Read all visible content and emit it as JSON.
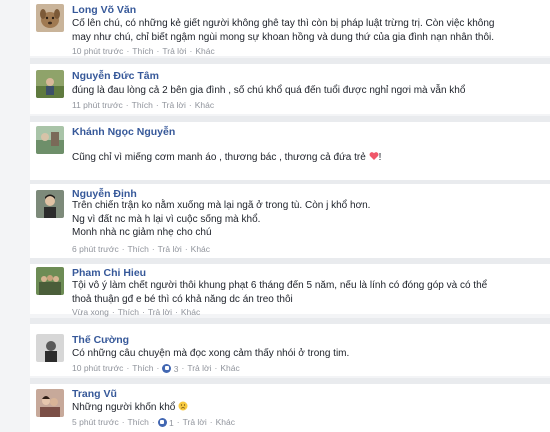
{
  "comments": [
    {
      "name": "Long Võ Văn",
      "lines": [
        "Cố lên chú, có những kẻ giết người không ghê tay thì còn bị pháp luật trừng trị. Còn việc không",
        "may như chú, chỉ biết ngậm ngùi mong sự khoan hồng và dung thứ của gia đình nạn nhân thôi."
      ],
      "time": "10 phút trước",
      "like": "Thích",
      "reply": "Trả lời",
      "other": "Khác",
      "avatar_icon": "dog-photo-icon"
    },
    {
      "name": "Nguyễn Đức Tâm",
      "lines": [
        "đúng là đau lòng cả 2 bên gia đình , số chú khổ quá đến tuổi được nghỉ ngơi mà vẫn khổ"
      ],
      "time": "11 phút trước",
      "like": "Thích",
      "reply": "Trả lời",
      "other": "Khác",
      "avatar_icon": "outdoor-photo-icon"
    },
    {
      "name": "Khánh Ngọc Nguyễn",
      "lines": [
        "Cũng chỉ vì miếng cơm manh áo , thương bác , thương cả đứa trẻ"
      ],
      "time": "",
      "like": "",
      "reply": "",
      "other": "",
      "avatar_icon": "landscape-photo-icon"
    },
    {
      "name": "Nguyễn Định",
      "lines": [
        "Trên chiến trận ko nằm xuống mà lại ngã ở trong tù. Còn j khổ hơn.",
        "Ng vì đất nc mà h lại vì cuộc sống mà khổ.",
        "Monh nhà nc giảm nhẹ cho chú"
      ],
      "time": "6 phút trước",
      "like": "Thích",
      "reply": "Trả lời",
      "other": "Khác",
      "avatar_icon": "portrait-photo-icon"
    },
    {
      "name": "Pham Chi Hieu",
      "lines": [
        "Tội vô ý làm chết người thôi khung phạt 6 tháng đến 5 năm, nếu là lính có đóng góp và có thể",
        "thoả thuận gđ e bé thì có khả năng dc án treo thôi"
      ],
      "time": "Vừa xong",
      "like": "Thích",
      "reply": "Trả lời",
      "other": "Khác",
      "avatar_icon": "group-photo-icon"
    },
    {
      "name": "Thế Cường",
      "lines": [
        "Có những câu chuyện mà đọc xong cảm thấy nhói ở trong tim."
      ],
      "time": "10 phút trước",
      "like": "Thích",
      "reply": "Trả lời",
      "other": "Khác",
      "like_count": "3",
      "avatar_icon": "bw-portrait-icon"
    },
    {
      "name": "Trang Vũ",
      "lines": [
        "Những người khốn khổ"
      ],
      "time": "5 phút trước",
      "like": "Thích",
      "reply": "Trả lời",
      "other": "Khác",
      "like_count": "1",
      "avatar_icon": "couple-photo-icon"
    }
  ],
  "colors": {
    "name": "#365899",
    "text": "#1d2129",
    "meta": "#90949c",
    "like_icon": "#4267b2",
    "heart": "#f0576a"
  }
}
